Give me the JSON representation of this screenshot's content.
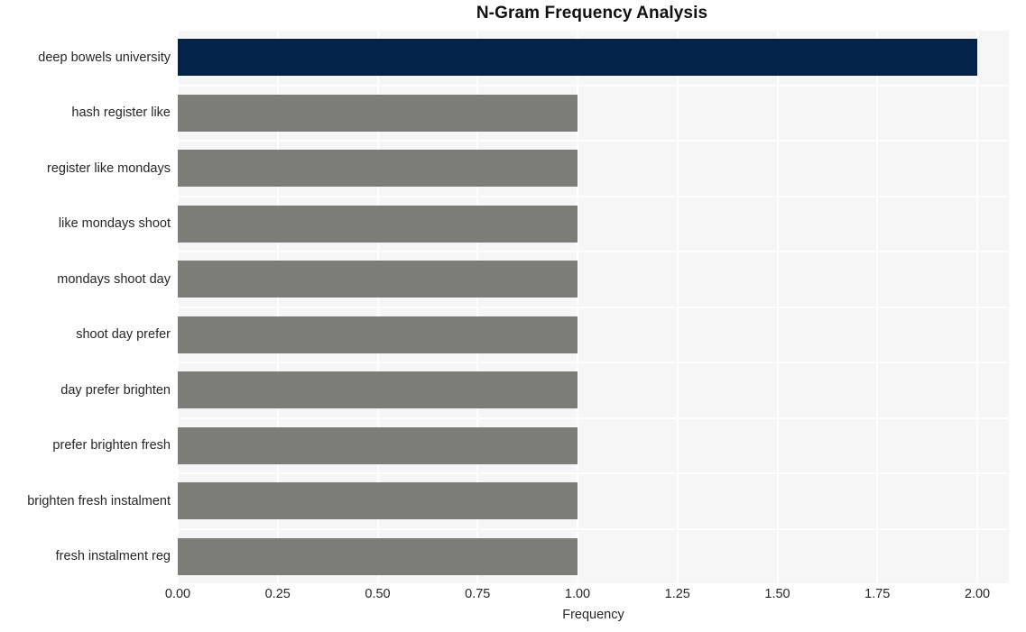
{
  "chart_data": {
    "type": "bar",
    "orientation": "horizontal",
    "title": "N-Gram Frequency Analysis",
    "xlabel": "Frequency",
    "ylabel": "",
    "categories": [
      "deep bowels university",
      "hash register like",
      "register like mondays",
      "like mondays shoot",
      "mondays shoot day",
      "shoot day prefer",
      "day prefer brighten",
      "prefer brighten fresh",
      "brighten fresh instalment",
      "fresh instalment reg"
    ],
    "values": [
      2,
      1,
      1,
      1,
      1,
      1,
      1,
      1,
      1,
      1
    ],
    "bar_colors": [
      "#03234b",
      "#7c7c79",
      "#7c7c79",
      "#7c7c79",
      "#7c7c79",
      "#7c7c79",
      "#7c7c79",
      "#7c7c79",
      "#7c7c79",
      "#7c7c79"
    ],
    "xlim": [
      0,
      2.1
    ],
    "xticks": [
      0,
      0.25,
      0.5,
      0.75,
      1,
      1.25,
      1.5,
      1.75,
      2
    ],
    "xtick_labels": [
      "0.00",
      "0.25",
      "0.50",
      "0.75",
      "1.00",
      "1.25",
      "1.50",
      "1.75",
      "2.00"
    ],
    "grid": true,
    "grid_color": "#ffffff",
    "legend": null,
    "plot_background": "#f6f6f7",
    "figure_background": "#ffffff",
    "highlight_color": "#03234b",
    "default_color": "#7c7c79"
  }
}
